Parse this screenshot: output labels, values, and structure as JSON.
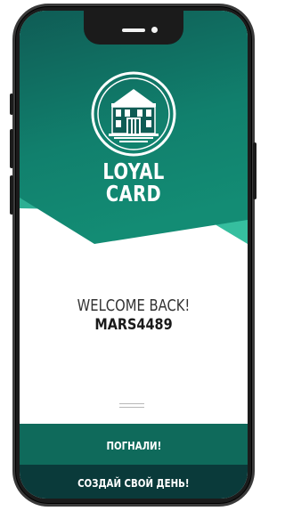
{
  "brand": {
    "line1": "LOYAL",
    "line2": "CARD"
  },
  "welcome": {
    "greeting": "WELCOME BACK!",
    "username": "MARS4489"
  },
  "buttons": {
    "go": "ПОГНАЛИ!",
    "create": "СОЗДАЙ СВОЙ ДЕНЬ!"
  },
  "colors": {
    "hero_dark": "#0f5c55",
    "hero_mid": "#11806d",
    "hero_light": "#2fb89a",
    "button_primary": "#0f6a5b",
    "button_secondary": "#0a3a3a"
  },
  "icons": [
    "building-logo-icon",
    "speaker",
    "front-camera"
  ]
}
